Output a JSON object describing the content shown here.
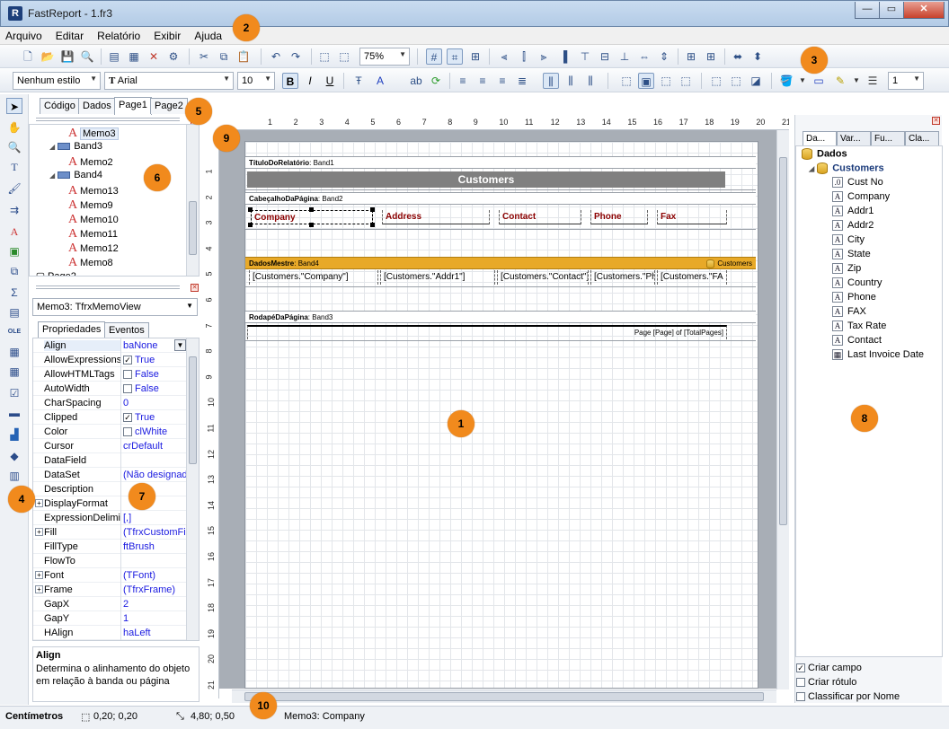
{
  "window": {
    "title": "FastReport - 1.fr3",
    "app_icon": "R"
  },
  "menu": [
    "Arquivo",
    "Editar",
    "Relatório",
    "Exibir",
    "Ajuda"
  ],
  "toolbar": {
    "zoom": "75%",
    "style": "Nenhum estilo",
    "font": "Arial",
    "font_size": "10",
    "frame_width": "1"
  },
  "left_tabs": [
    "Código",
    "Dados",
    "Page1",
    "Page2"
  ],
  "tree": [
    {
      "label": "Memo3",
      "kind": "memo",
      "level": 3,
      "selected": true
    },
    {
      "label": "Band3",
      "kind": "band",
      "level": 2
    },
    {
      "label": "Memo2",
      "kind": "memo",
      "level": 3
    },
    {
      "label": "Band4",
      "kind": "band",
      "level": 2
    },
    {
      "label": "Memo13",
      "kind": "memo",
      "level": 3
    },
    {
      "label": "Memo9",
      "kind": "memo",
      "level": 3
    },
    {
      "label": "Memo10",
      "kind": "memo",
      "level": 3
    },
    {
      "label": "Memo11",
      "kind": "memo",
      "level": 3
    },
    {
      "label": "Memo12",
      "kind": "memo",
      "level": 3
    },
    {
      "label": "Memo8",
      "kind": "memo",
      "level": 3
    },
    {
      "label": "Page2",
      "kind": "page",
      "level": 1
    }
  ],
  "object_inspector": {
    "object": "Memo3: TfrxMemoView",
    "tabs": [
      "Propriedades",
      "Eventos"
    ],
    "properties": [
      {
        "name": "Align",
        "value": "baNone",
        "dropdown": true
      },
      {
        "name": "AllowExpressions",
        "value": "True",
        "check": true
      },
      {
        "name": "AllowHTMLTags",
        "value": "False",
        "check": false
      },
      {
        "name": "AutoWidth",
        "value": "False",
        "check": false
      },
      {
        "name": "CharSpacing",
        "value": "0"
      },
      {
        "name": "Clipped",
        "value": "True",
        "check": true
      },
      {
        "name": "Color",
        "value": "clWhite",
        "swatch": true
      },
      {
        "name": "Cursor",
        "value": "crDefault"
      },
      {
        "name": "DataField",
        "value": ""
      },
      {
        "name": "DataSet",
        "value": "(Não designado)"
      },
      {
        "name": "Description",
        "value": ""
      },
      {
        "name": "DisplayFormat",
        "value": "",
        "expand": true
      },
      {
        "name": "ExpressionDelimiters",
        "value": "[,]"
      },
      {
        "name": "Fill",
        "value": "(TfrxCustomFill)",
        "expand": true
      },
      {
        "name": "FillType",
        "value": "ftBrush"
      },
      {
        "name": "FlowTo",
        "value": ""
      },
      {
        "name": "Font",
        "value": "(TFont)",
        "expand": true
      },
      {
        "name": "Frame",
        "value": "(TfrxFrame)",
        "expand": true
      },
      {
        "name": "GapX",
        "value": "2"
      },
      {
        "name": "GapY",
        "value": "1"
      },
      {
        "name": "HAlign",
        "value": "haLeft"
      }
    ],
    "help_title": "Align",
    "help_text": "Determina o alinhamento do objeto em relação à banda ou página"
  },
  "ruler": {
    "h": [
      "1",
      "2",
      "3",
      "4",
      "5",
      "6",
      "7",
      "8",
      "9",
      "10",
      "11",
      "12",
      "13",
      "14",
      "15",
      "16",
      "17",
      "18",
      "19",
      "20",
      "21"
    ],
    "v": [
      "1",
      "2",
      "3",
      "4",
      "5",
      "6",
      "7",
      "8",
      "9",
      "10",
      "11",
      "12",
      "13",
      "14",
      "15",
      "16",
      "17",
      "18",
      "19",
      "20",
      "21"
    ]
  },
  "report": {
    "title_band": {
      "kind": "TítuloDoRelatório",
      "name": "Band1",
      "title": "Customers"
    },
    "page_header_band": {
      "kind": "CabeçalhoDaPágina",
      "name": "Band2",
      "columns": [
        "Company",
        "Address",
        "Contact",
        "Phone",
        "Fax"
      ]
    },
    "master_band": {
      "kind": "DadosMestre",
      "name": "Band4",
      "dataset": "Customers",
      "fields": [
        "[Customers.\"Company\"]",
        "[Customers.\"Addr1\"]",
        "[Customers.\"Contact\"]",
        "[Customers.\"Ph",
        "[Customers.\"FA"
      ]
    },
    "page_footer_band": {
      "kind": "RodapéDaPágina",
      "name": "Band3",
      "text": "Page [Page] of [TotalPages]"
    }
  },
  "data_panel": {
    "tabs": [
      "Da...",
      "Var...",
      "Fu...",
      "Cla..."
    ],
    "root": "Dados",
    "dataset": "Customers",
    "fields": [
      {
        "name": "Cust No",
        "type": "num"
      },
      {
        "name": "Company",
        "type": "text"
      },
      {
        "name": "Addr1",
        "type": "text"
      },
      {
        "name": "Addr2",
        "type": "text"
      },
      {
        "name": "City",
        "type": "text"
      },
      {
        "name": "State",
        "type": "text"
      },
      {
        "name": "Zip",
        "type": "text"
      },
      {
        "name": "Country",
        "type": "text"
      },
      {
        "name": "Phone",
        "type": "text"
      },
      {
        "name": "FAX",
        "type": "text"
      },
      {
        "name": "Tax Rate",
        "type": "text"
      },
      {
        "name": "Contact",
        "type": "text"
      },
      {
        "name": "Last Invoice Date",
        "type": "date"
      }
    ],
    "options": [
      {
        "label": "Criar campo",
        "checked": true
      },
      {
        "label": "Criar rótulo",
        "checked": false
      },
      {
        "label": "Classificar por Nome",
        "checked": false
      }
    ]
  },
  "status": {
    "units": "Centímetros",
    "position": "0,20; 0,20",
    "size": "4,80; 0,50",
    "object": "Memo3: Company"
  },
  "callouts": [
    "1",
    "2",
    "3",
    "4",
    "5",
    "6",
    "7",
    "8",
    "9",
    "10"
  ],
  "colors": {
    "accent": "#f18a1d",
    "master_band": "#e8a928",
    "title_fill": "#808080"
  }
}
